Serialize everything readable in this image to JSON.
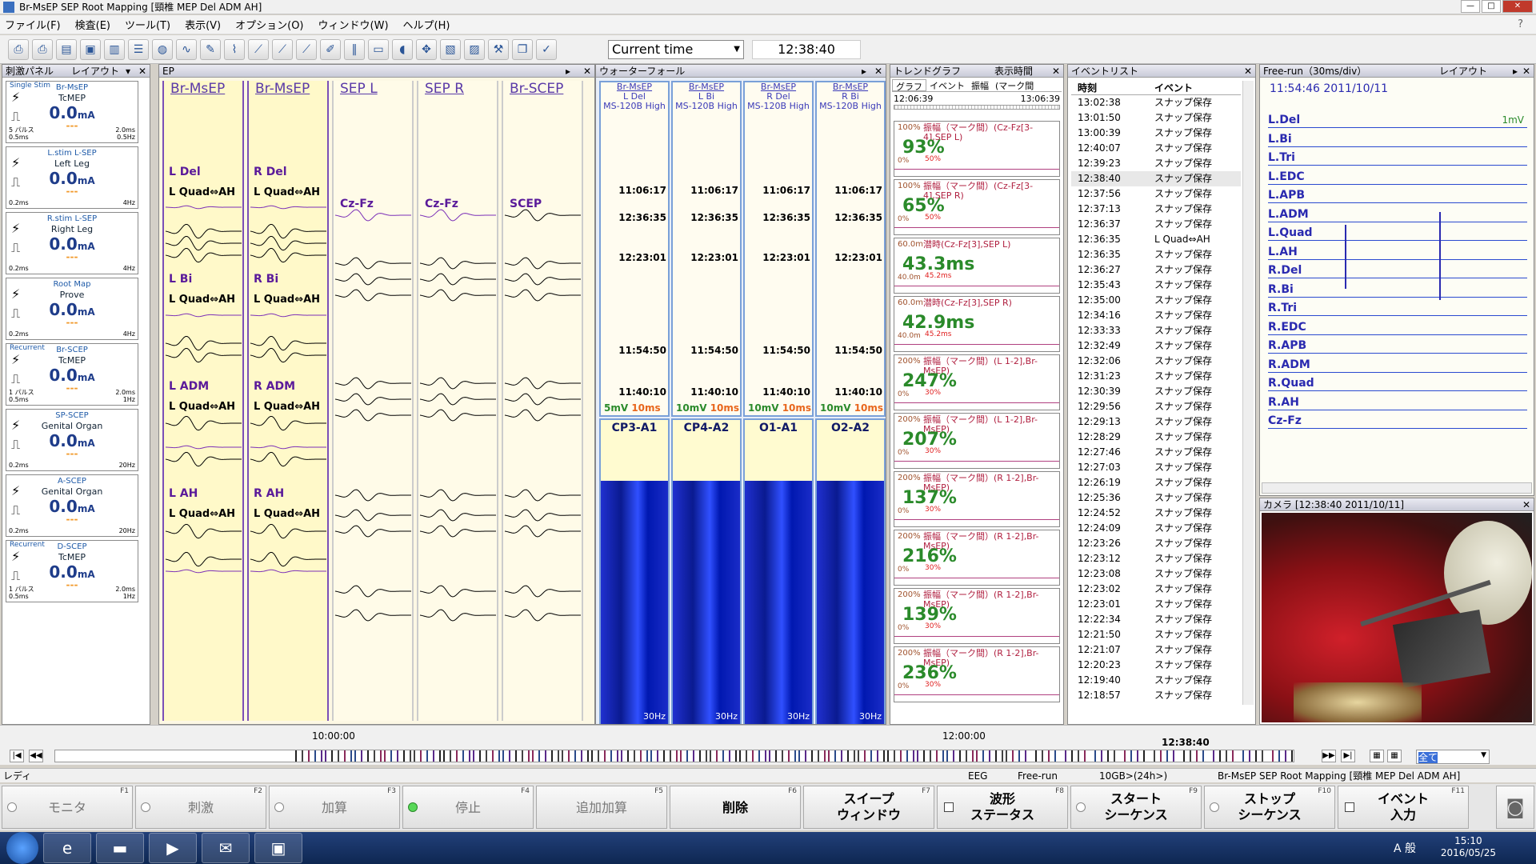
{
  "window": {
    "title": "Br-MsEP SEP Root Mapping [頸椎 MEP Del ADM AH]"
  },
  "menu": [
    "ファイル(F)",
    "検査(E)",
    "ツール(T)",
    "表示(V)",
    "オプション(O)",
    "ウィンドウ(W)",
    "ヘルプ(H)"
  ],
  "toolbar": {
    "time_mode": "Current time",
    "time_value": "12:38:40"
  },
  "stim_panel": {
    "title": "刺激パネル",
    "layout": "レイアウト",
    "items": [
      {
        "lt": "Single Stim",
        "n1": "Br-MsEP",
        "n2": "TcMEP",
        "val": "0.0",
        "unit": "mA",
        "dash": "---",
        "bl": "5 パルス\n0.5ms",
        "br": "2.0ms\n0.5Hz"
      },
      {
        "lt": "",
        "n1": "L.stim L-SEP",
        "n2": "Left Leg",
        "val": "0.0",
        "unit": "mA",
        "dash": "---",
        "bl": "0.2ms",
        "br": "4Hz"
      },
      {
        "lt": "",
        "n1": "R.stim L-SEP",
        "n2": "Right Leg",
        "val": "0.0",
        "unit": "mA",
        "dash": "---",
        "bl": "0.2ms",
        "br": "4Hz"
      },
      {
        "lt": "",
        "n1": "Root Map",
        "n2": "Prove",
        "val": "0.0",
        "unit": "mA",
        "dash": "---",
        "bl": "0.2ms",
        "br": "4Hz"
      },
      {
        "lt": "Recurrent",
        "n1": "Br-SCEP",
        "n2": "TcMEP",
        "val": "0.0",
        "unit": "mA",
        "dash": "---",
        "bl": "1 パルス\n0.5ms",
        "br": "2.0ms\n1Hz"
      },
      {
        "lt": "",
        "n1": "SP-SCEP",
        "n2": "Genital Organ",
        "val": "0.0",
        "unit": "mA",
        "dash": "---",
        "bl": "0.2ms",
        "br": "20Hz"
      },
      {
        "lt": "",
        "n1": "A-SCEP",
        "n2": "Genital Organ",
        "val": "0.0",
        "unit": "mA",
        "dash": "---",
        "bl": "0.2ms",
        "br": "20Hz"
      },
      {
        "lt": "Recurrent",
        "n1": "D-SCEP",
        "n2": "TcMEP",
        "val": "0.0",
        "unit": "mA",
        "dash": "---",
        "bl": "1 パルス\n0.5ms",
        "br": "2.0ms\n1Hz"
      }
    ]
  },
  "ep": {
    "title": "EP",
    "columns": [
      "Br-MsEP",
      "Br-MsEP",
      "SEP L",
      "SEP R",
      "Br-SCEP"
    ],
    "labels": {
      "c1": [
        "L Del",
        "L Quad⇔AH",
        "L Bi",
        "L Quad⇔AH",
        "L ADM",
        "L Quad⇔AH",
        "L AH",
        "L Quad⇔AH"
      ],
      "c2": [
        "R Del",
        "L Quad⇔AH",
        "R Bi",
        "L Quad⇔AH",
        "R ADM",
        "L Quad⇔AH",
        "R AH",
        "L Quad⇔AH"
      ],
      "c3": "Cz-Fz",
      "c4": "Cz-Fz",
      "c5": "SCEP"
    }
  },
  "waterfall": {
    "title": "ウォーターフォール",
    "columns": [
      {
        "link": "Br-MsEP",
        "ch": "L Del",
        "filter": "MS-120B High",
        "scale": "5mV",
        "time": "10ms"
      },
      {
        "link": "Br-MsEP",
        "ch": "L Bi",
        "filter": "MS-120B High",
        "scale": "10mV",
        "time": "10ms"
      },
      {
        "link": "Br-MsEP",
        "ch": "R Del",
        "filter": "MS-120B High",
        "scale": "10mV",
        "time": "10ms"
      },
      {
        "link": "Br-MsEP",
        "ch": "R Bi",
        "filter": "MS-120B High",
        "scale": "10mV",
        "time": "10ms"
      }
    ],
    "times": [
      "11:06:17",
      "12:36:35",
      "12:23:01",
      "11:54:50",
      "11:40:10"
    ],
    "spectra": [
      "CP3-A1",
      "CP4-A2",
      "O1-A1",
      "O2-A2"
    ],
    "spec_hz": "30Hz"
  },
  "trend": {
    "title": "トレンドグラフ",
    "display_time": "表示時間",
    "tabs": [
      "グラフ",
      "イベント",
      "振幅",
      "(マーク間"
    ],
    "t_start": "12:06:39",
    "t_end": "13:06:39",
    "items": [
      {
        "top": "100%",
        "label": "振幅（マーク間）(Cz-Fz[3-4],SEP L)",
        "value": "93%",
        "zero": "0%",
        "lim": "50%"
      },
      {
        "top": "100%",
        "label": "振幅（マーク間）(Cz-Fz[3-4],SEP R)",
        "value": "65%",
        "zero": "0%",
        "lim": "50%"
      },
      {
        "top": "60.0m",
        "label": "潜時(Cz-Fz[3],SEP L)",
        "value": "43.3ms",
        "zero": "40.0m",
        "lim": "45.2ms"
      },
      {
        "top": "60.0m",
        "label": "潜時(Cz-Fz[3],SEP R)",
        "value": "42.9ms",
        "zero": "40.0m",
        "lim": "45.2ms"
      },
      {
        "top": "200%",
        "label": "振幅（マーク間）(L 1-2],Br-MsEP)",
        "value": "247%",
        "zero": "0%",
        "lim": "30%"
      },
      {
        "top": "200%",
        "label": "振幅（マーク間）(L 1-2],Br-MsEP)",
        "value": "207%",
        "zero": "0%",
        "lim": "30%"
      },
      {
        "top": "200%",
        "label": "振幅（マーク間）(R 1-2],Br-MsEP)",
        "value": "137%",
        "zero": "0%",
        "lim": "30%"
      },
      {
        "top": "200%",
        "label": "振幅（マーク間）(R 1-2],Br-MsEP)",
        "value": "216%",
        "zero": "0%",
        "lim": "30%"
      },
      {
        "top": "200%",
        "label": "振幅（マーク間）(R 1-2],Br-MsEP)",
        "value": "139%",
        "zero": "0%",
        "lim": "30%"
      },
      {
        "top": "200%",
        "label": "振幅（マーク間）(R 1-2],Br-MsEP)",
        "value": "236%",
        "zero": "0%",
        "lim": "30%"
      }
    ]
  },
  "events": {
    "title": "イベントリスト",
    "col_time": "時刻",
    "col_event": "イベント",
    "rows": [
      [
        "13:02:38",
        "スナップ保存"
      ],
      [
        "13:01:50",
        "スナップ保存"
      ],
      [
        "13:00:39",
        "スナップ保存"
      ],
      [
        "12:40:07",
        "スナップ保存"
      ],
      [
        "12:39:23",
        "スナップ保存"
      ],
      [
        "12:38:40",
        "スナップ保存"
      ],
      [
        "12:37:56",
        "スナップ保存"
      ],
      [
        "12:37:13",
        "スナップ保存"
      ],
      [
        "12:36:37",
        "スナップ保存"
      ],
      [
        "12:36:35",
        "L Quad⇔AH"
      ],
      [
        "12:36:35",
        "スナップ保存"
      ],
      [
        "12:36:27",
        "スナップ保存"
      ],
      [
        "12:35:43",
        "スナップ保存"
      ],
      [
        "12:35:00",
        "スナップ保存"
      ],
      [
        "12:34:16",
        "スナップ保存"
      ],
      [
        "12:33:33",
        "スナップ保存"
      ],
      [
        "12:32:49",
        "スナップ保存"
      ],
      [
        "12:32:06",
        "スナップ保存"
      ],
      [
        "12:31:23",
        "スナップ保存"
      ],
      [
        "12:30:39",
        "スナップ保存"
      ],
      [
        "12:29:56",
        "スナップ保存"
      ],
      [
        "12:29:13",
        "スナップ保存"
      ],
      [
        "12:28:29",
        "スナップ保存"
      ],
      [
        "12:27:46",
        "スナップ保存"
      ],
      [
        "12:27:03",
        "スナップ保存"
      ],
      [
        "12:26:19",
        "スナップ保存"
      ],
      [
        "12:25:36",
        "スナップ保存"
      ],
      [
        "12:24:52",
        "スナップ保存"
      ],
      [
        "12:24:09",
        "スナップ保存"
      ],
      [
        "12:23:26",
        "スナップ保存"
      ],
      [
        "12:23:12",
        "スナップ保存"
      ],
      [
        "12:23:08",
        "スナップ保存"
      ],
      [
        "12:23:02",
        "スナップ保存"
      ],
      [
        "12:23:01",
        "スナップ保存"
      ],
      [
        "12:22:34",
        "スナップ保存"
      ],
      [
        "12:21:50",
        "スナップ保存"
      ],
      [
        "12:21:07",
        "スナップ保存"
      ],
      [
        "12:20:23",
        "スナップ保存"
      ],
      [
        "12:19:40",
        "スナップ保存"
      ],
      [
        "12:18:57",
        "スナップ保存"
      ]
    ]
  },
  "freerun": {
    "title": "Free-run（30ms/div）",
    "layout": "レイアウト",
    "timestamp": "11:54:46 2011/10/11",
    "scale": "1mV",
    "channels": [
      "L.Del",
      "L.Bi",
      "L.Tri",
      "L.EDC",
      "L.APB",
      "L.ADM",
      "L.Quad",
      "L.AH",
      "R.Del",
      "R.Bi",
      "R.Tri",
      "R.EDC",
      "R.APB",
      "R.ADM",
      "R.Quad",
      "R.AH",
      "Cz-Fz"
    ]
  },
  "camera": {
    "title": "カメラ [12:38:40 2011/10/11]"
  },
  "timeline": {
    "t1": "10:00:00",
    "t2": "12:00:00",
    "cur": "12:38:40",
    "select": "全て"
  },
  "status": {
    "left": "レディ",
    "eeg": "EEG",
    "mode": "Free-run",
    "disk": "10GB>(24h>)",
    "exam": "Br-MsEP SEP Root Mapping [頸椎 MEP Del ADM AH]"
  },
  "fkeys": [
    {
      "fn": "F1",
      "l1": "モニタ",
      "l2": ""
    },
    {
      "fn": "F2",
      "l1": "刺激",
      "l2": ""
    },
    {
      "fn": "F3",
      "l1": "加算",
      "l2": ""
    },
    {
      "fn": "F4",
      "l1": "停止",
      "l2": ""
    },
    {
      "fn": "F5",
      "l1": "追加加算",
      "l2": ""
    },
    {
      "fn": "F6",
      "l1": "削除",
      "l2": ""
    },
    {
      "fn": "F7",
      "l1": "スイープ",
      "l2": "ウィンドウ"
    },
    {
      "fn": "F8",
      "l1": "波形",
      "l2": "ステータス"
    },
    {
      "fn": "F9",
      "l1": "スタート",
      "l2": "シーケンス"
    },
    {
      "fn": "F10",
      "l1": "ストップ",
      "l2": "シーケンス"
    },
    {
      "fn": "F11",
      "l1": "イベント",
      "l2": "入力"
    }
  ],
  "taskbar": {
    "ime": "A 般",
    "time": "15:10",
    "date": "2016/05/25"
  }
}
